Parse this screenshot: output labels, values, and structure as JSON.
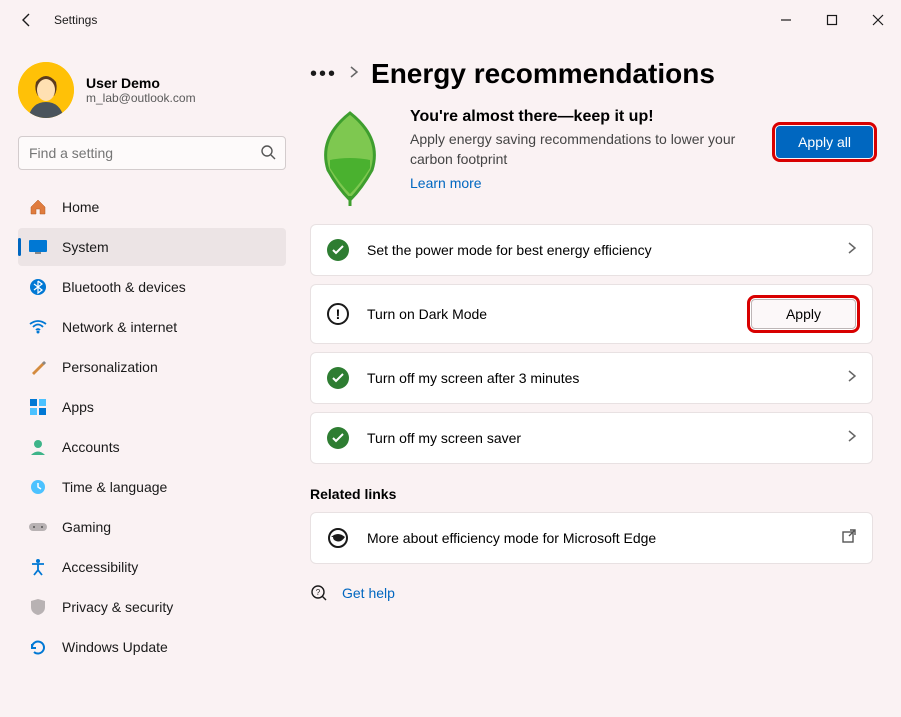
{
  "window": {
    "title": "Settings"
  },
  "user": {
    "name": "User Demo",
    "email": "m_lab@outlook.com"
  },
  "search": {
    "placeholder": "Find a setting"
  },
  "nav": {
    "items": [
      {
        "label": "Home"
      },
      {
        "label": "System"
      },
      {
        "label": "Bluetooth & devices"
      },
      {
        "label": "Network & internet"
      },
      {
        "label": "Personalization"
      },
      {
        "label": "Apps"
      },
      {
        "label": "Accounts"
      },
      {
        "label": "Time & language"
      },
      {
        "label": "Gaming"
      },
      {
        "label": "Accessibility"
      },
      {
        "label": "Privacy & security"
      },
      {
        "label": "Windows Update"
      }
    ],
    "activeIndex": 1
  },
  "breadcrumb": {
    "ellipsis": "•••",
    "page": "Energy recommendations"
  },
  "hero": {
    "title": "You're almost there—keep it up!",
    "subtitle": "Apply energy saving recommendations to lower your carbon footprint",
    "learn_more": "Learn more",
    "apply_all": "Apply all"
  },
  "recs": [
    {
      "status": "done",
      "label": "Set the power mode for best energy efficiency",
      "action": "expand"
    },
    {
      "status": "pending",
      "label": "Turn on Dark Mode",
      "action": "apply",
      "apply_label": "Apply"
    },
    {
      "status": "done",
      "label": "Turn off my screen after 3 minutes",
      "action": "expand"
    },
    {
      "status": "done",
      "label": "Turn off my screen saver",
      "action": "expand"
    }
  ],
  "related": {
    "heading": "Related links",
    "edge": "More about efficiency mode for Microsoft Edge"
  },
  "help": {
    "label": "Get help"
  }
}
